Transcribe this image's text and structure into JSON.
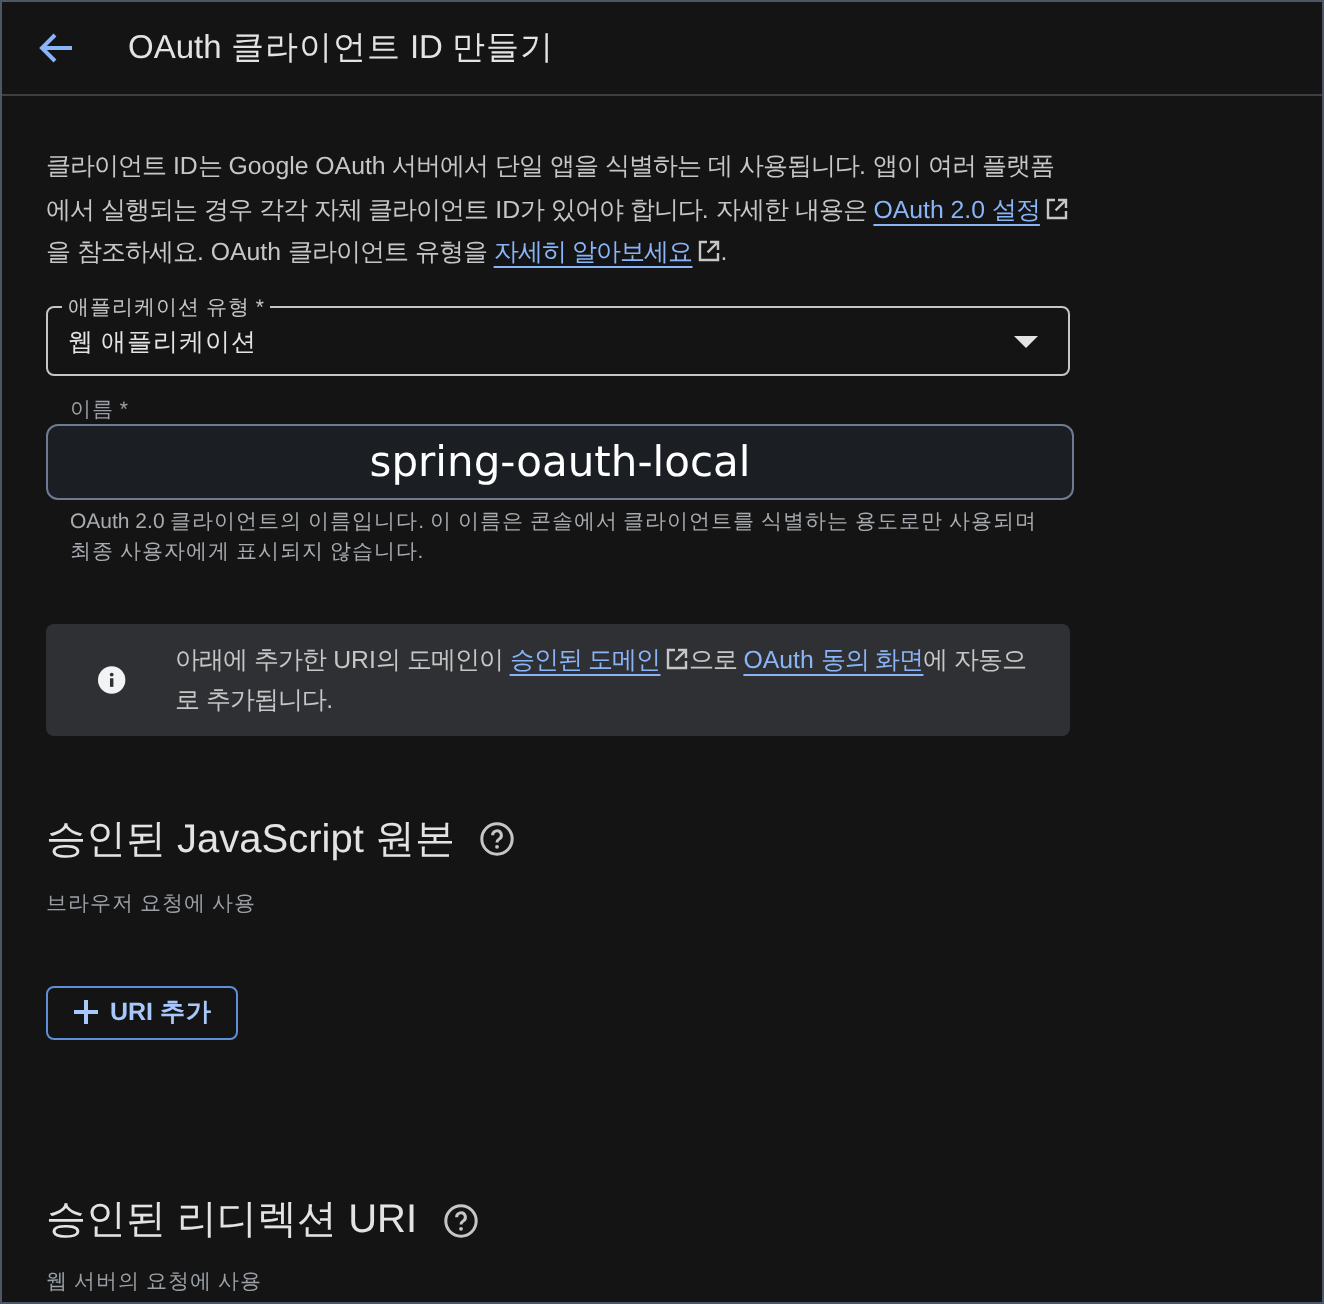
{
  "header": {
    "title": "OAuth 클라이언트 ID 만들기"
  },
  "intro": [
    {
      "kind": "text",
      "text": "클라이언트 ID는 Google OAuth 서버에서 단일 앱을 식별하는 데 사용됩니다. 앱이 여러 플랫폼에서 실행되는 경우 각각 자체 클라이언트 ID가 있어야 합니다. 자세한 내용은 "
    },
    {
      "kind": "link",
      "text": "OAuth 2.0 설정",
      "external": true
    },
    {
      "kind": "text",
      "text": "을 참조하세요. OAuth 클라이언트 유형을 "
    },
    {
      "kind": "link",
      "text": "자세히 알아보세요",
      "external": true
    },
    {
      "kind": "text",
      "text": "."
    }
  ],
  "app_type": {
    "label": "애플리케이션 유형 *",
    "value": "웹 애플리케이션"
  },
  "name_field": {
    "label": "이름 *",
    "value": "spring-oauth-local",
    "hint": "OAuth 2.0 클라이언트의 이름입니다. 이 이름은 콘솔에서 클라이언트를 식별하는 용도로만 사용되며 최종 사용자에게 표시되지 않습니다."
  },
  "info": [
    {
      "kind": "text",
      "text": "아래에 추가한 URI의 도메인이 "
    },
    {
      "kind": "link",
      "text": "승인된 도메인",
      "external": true
    },
    {
      "kind": "text",
      "text": "으로 "
    },
    {
      "kind": "link",
      "text": "OAuth 동의 화면",
      "external": false
    },
    {
      "kind": "text",
      "text": "에 자동으로 추가됩니다."
    }
  ],
  "sections": [
    {
      "title": "승인된 JavaScript 원본",
      "subtitle": "브라우저 요청에 사용",
      "button": "URI 추가"
    },
    {
      "title": "승인된 리디렉션 URI",
      "subtitle": "웹 서버의 요청에 사용"
    }
  ]
}
